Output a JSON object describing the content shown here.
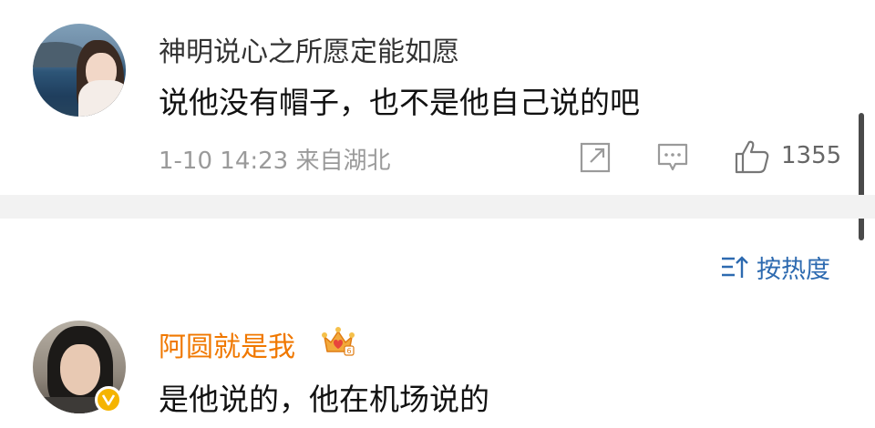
{
  "comments": [
    {
      "username": "神明说心之所愿定能如愿",
      "text": "说他没有帽子，也不是他自己说的吧",
      "meta": "1-10 14:23  来自湖北",
      "likes": "1355",
      "username_color": "#333333"
    },
    {
      "username": "阿圆就是我",
      "text": "是他说的，他在机场说的",
      "username_color": "#f07800",
      "verified_badge": "v-badge",
      "vip_badge": "crown-icon"
    }
  ],
  "sort": {
    "label": "按热度",
    "icon": "sort-icon",
    "color": "#2d6ab0"
  },
  "icons": {
    "share": "share-icon",
    "comment": "comment-icon",
    "like": "like-icon"
  }
}
